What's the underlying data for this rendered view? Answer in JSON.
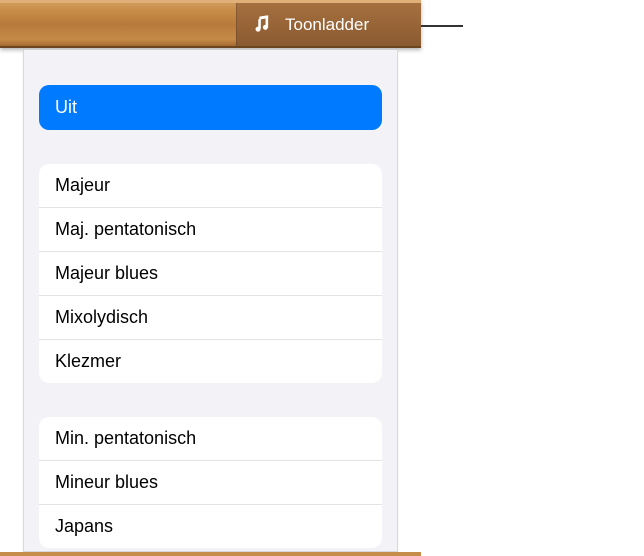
{
  "header": {
    "tab_label": "Toonladder"
  },
  "selected": {
    "label": "Uit"
  },
  "groups": [
    {
      "items": [
        {
          "label": "Majeur"
        },
        {
          "label": "Maj. pentatonisch"
        },
        {
          "label": "Majeur blues"
        },
        {
          "label": "Mixolydisch"
        },
        {
          "label": "Klezmer"
        }
      ]
    },
    {
      "items": [
        {
          "label": "Min. pentatonisch"
        },
        {
          "label": "Mineur blues"
        },
        {
          "label": "Japans"
        }
      ]
    }
  ]
}
